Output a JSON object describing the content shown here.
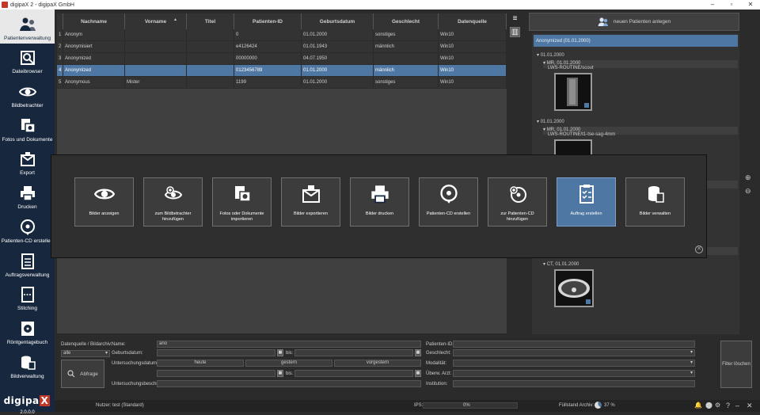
{
  "window": {
    "title": "digipaX 2 - digipaX GmbH",
    "controls": [
      "–",
      "▫",
      "✕"
    ]
  },
  "sidebar": {
    "items": [
      {
        "label": "Patientenverwaltung",
        "icon": "patients-icon",
        "active": true
      },
      {
        "label": "Dateibrowser",
        "icon": "file-browser-icon",
        "active": false
      },
      {
        "label": "Bildbetrachter",
        "icon": "eye-icon",
        "active": false
      },
      {
        "label": "Fotos und Dokumente",
        "icon": "photo-docs-icon",
        "active": false
      },
      {
        "label": "Export",
        "icon": "export-icon",
        "active": false
      },
      {
        "label": "Drucken",
        "icon": "printer-icon",
        "active": false
      },
      {
        "label": "Patienten-CD erstellen",
        "icon": "cd-burn-icon",
        "active": false
      },
      {
        "label": "Auftragsverwaltung",
        "icon": "order-list-icon",
        "active": false
      },
      {
        "label": "Stitching",
        "icon": "stitching-icon",
        "active": false
      },
      {
        "label": "Röntgentagebuch",
        "icon": "radiation-book-icon",
        "active": false
      },
      {
        "label": "Bildverwaltung",
        "icon": "image-db-icon",
        "active": false
      }
    ],
    "logo_text": "digipa",
    "logo_x": "X",
    "version": "2.0.0.0"
  },
  "table": {
    "headers": [
      "",
      "Nachname",
      "Vorname",
      "Titel",
      "Patienten-ID",
      "Geburtsdatum",
      "Geschlecht",
      "Datenquelle"
    ],
    "rows": [
      [
        "1",
        "Anonym",
        "",
        "",
        "0",
        "01.01.2000",
        "sonstiges",
        "Win10"
      ],
      [
        "2",
        "Anonymisiert",
        "",
        "",
        "e4126424",
        "01.01.1943",
        "männlich",
        "Win10"
      ],
      [
        "3",
        "Anonymized",
        "",
        "",
        "00000000",
        "04.07.1950",
        "",
        "Win10"
      ],
      [
        "4",
        "Anonymized",
        "",
        "",
        "0123456789",
        "01.01.2000",
        "männlich",
        "Win10"
      ],
      [
        "5",
        "Anonymous",
        "Mister",
        "",
        "1199",
        "01.01.2000",
        "sonstiges",
        "Win10"
      ]
    ],
    "selected_row": 3
  },
  "tree": {
    "new_patient_label": "neuen Patienten anlegen",
    "root": "Anonymized (01.01.2000)",
    "date1": "01.01.2000",
    "study1": "MR, 01.01.2000",
    "series1": "LWS-ROUTINE/scout",
    "date2": "01.01.2000",
    "study2": "MR, 01.01.2000",
    "series2": "LWS-ROUTINE/t1-tse-sag-4mm",
    "study3": "CT, 01.01.2000"
  },
  "overlay": {
    "tiles": [
      {
        "label": "Bilder anzeigen",
        "icon": "eye-icon"
      },
      {
        "label": "zum Bildbetrachter hinzufügen",
        "icon": "add-to-viewer-icon"
      },
      {
        "label": "Fotos oder Dokumente importieren",
        "icon": "import-photo-icon"
      },
      {
        "label": "Bilder exportieren",
        "icon": "export-images-icon"
      },
      {
        "label": "Bilder drucken",
        "icon": "printer-icon"
      },
      {
        "label": "Patienten-CD erstellen",
        "icon": "cd-burn-icon"
      },
      {
        "label": "zur Patienten-CD hinzufügen",
        "icon": "add-to-cd-icon"
      },
      {
        "label": "Auftrag erstellen",
        "icon": "create-order-icon",
        "highlight": true
      },
      {
        "label": "Bilder verwalten",
        "icon": "manage-images-icon"
      }
    ],
    "close": "✕"
  },
  "filter": {
    "source_label": "Datenquelle / Bildarchiv:",
    "source_value": "alle",
    "name_label": "Name:",
    "name_value": "ano",
    "birth_label": "Geburtsdatum:",
    "bis_label": "bis:",
    "exam_date_label": "Untersuchungsdatum:",
    "today": "heute",
    "yesterday": "gestern",
    "day_before": "vorgestern",
    "exam_desc_label": "Untersuchungsbeschr.:",
    "abfrage_label": "Abfrage",
    "patient_id_label": "Patienten-ID:",
    "gender_label": "Geschlecht:",
    "modality_label": "Modalität:",
    "referrer_label": "Überw. Arzt:",
    "institution_label": "Institution:",
    "filter_clear_label": "Filter löschen"
  },
  "status": {
    "user": "Nutzer: test (Standard)",
    "ips_label": "IPS:",
    "ips_value": "0%",
    "archive_label": "Füllstand Archiv:",
    "archive_value": "37 %"
  },
  "colors": {
    "sidebar": "#17283e",
    "accent": "#4f77a3",
    "logo_red": "#c0392b"
  }
}
